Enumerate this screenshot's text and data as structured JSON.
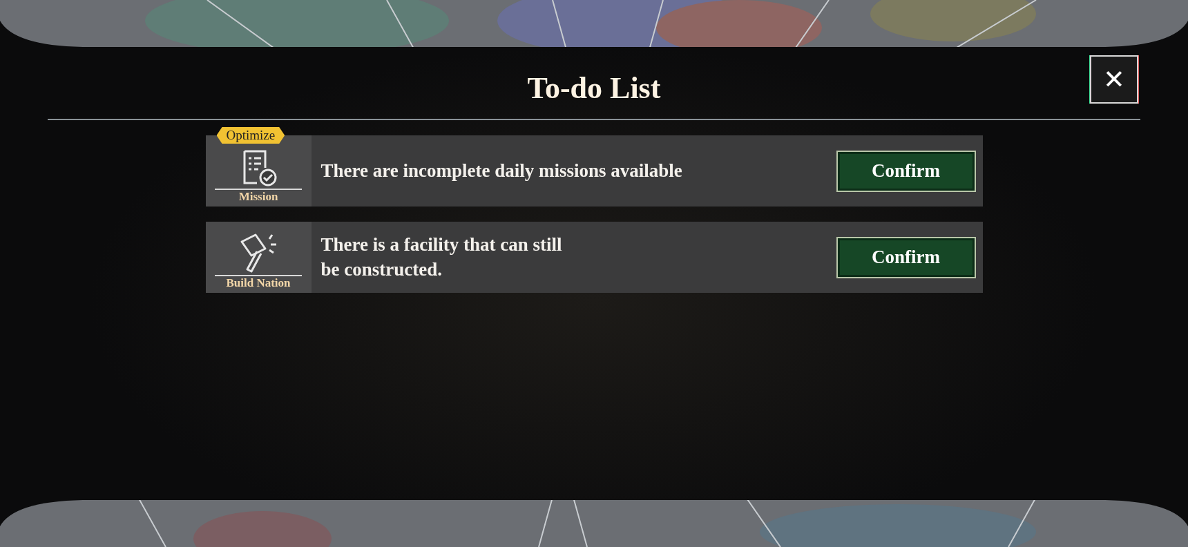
{
  "title": "To-do List",
  "close": {
    "label": "✕"
  },
  "items": [
    {
      "kind": "mission",
      "badge": "Optimize",
      "category": "Mission",
      "message": "There are incomplete daily missions available",
      "button": "Confirm"
    },
    {
      "kind": "build",
      "category": "Build Nation",
      "message": "There is a facility that can still\nbe constructed.",
      "button": "Confirm"
    }
  ]
}
